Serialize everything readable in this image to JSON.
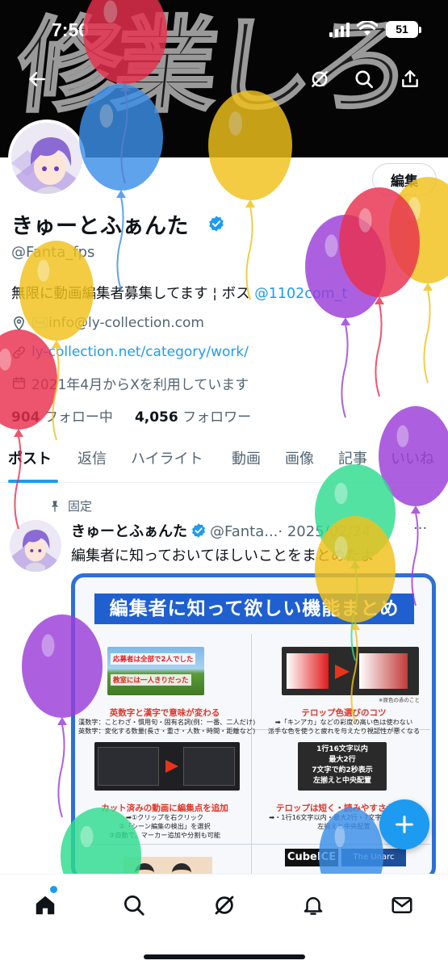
{
  "status_bar": {
    "time": "7:50",
    "battery": "51"
  },
  "banner": {
    "art_text": "修業しろ"
  },
  "header": {
    "back_icon": "arrow-left-icon",
    "grok_icon": "grok-icon",
    "search_icon": "search-icon",
    "share_icon": "share-icon"
  },
  "profile": {
    "edit_label": "編集",
    "display_name": "きゅーとふぁんた",
    "handle": "@Fanta_fps",
    "bio_text": "無限に動画編集者募集してます ¦ ボス ",
    "bio_link": "@1102com_t",
    "email": "✉️info@ly-collection.com",
    "website": "ly-collection.net/category/work/",
    "joined": "2021年4月からXを利用しています",
    "following_count": "904",
    "following_label": "フォロー中",
    "followers_count": "4,056",
    "followers_label": "フォロワー"
  },
  "tabs": [
    "ポスト",
    "返信",
    "ハイライト",
    "動画",
    "画像",
    "記事",
    "いいね"
  ],
  "post": {
    "pinned_label": "固定",
    "name": "きゅーとふぁんた",
    "handle": "@Fanta...",
    "date": "· 2025/02/24",
    "more": "···",
    "text": "編集者に知っておいてほしいことをまとめたよ",
    "image": {
      "title": "編集者に知って欲しい機能まとめ",
      "cells": [
        {
          "thumb_text_1": "応募者は全部で2人でした",
          "thumb_text_2": "教室には一人きりだった",
          "heading": "英数字と漢字で意味が変わる",
          "desc_1": "漢数字：ことわざ・慣用句・固有名詞(例：一番、二人だけ)",
          "desc_2": "英数字：変化する数量(長さ・重さ・人数・時間・距離など)"
        },
        {
          "note": "※原色の赤のこと",
          "heading": "テロップ色選びのコツ",
          "desc_1": "➡「キンアカ」などの彩度の高い色は使わない",
          "desc_2": "派手な色を使うと疲れを与えたり視認性が悪くなる"
        },
        {
          "heading": "カット済みの動画に編集点を追加",
          "desc_1": "➡①クリップを右クリック",
          "desc_2": "②「シーン編集の検出」を選択",
          "desc_3": "③自動で、マーカー追加や分割も可能"
        },
        {
          "thumb_lines": [
            "1行16文字以内",
            "最大2行",
            "7文字で約2秒表示",
            "左揃えと中央配置"
          ],
          "heading": "テロップは短く・読みやすさが基本",
          "desc_1": "➡・1行16文字以内・最大2行・7文字で約2秒表示",
          "desc_2": "左揃えと中央配置"
        },
        {
          "logo_text": "CubeICE",
          "logo_text_2": "The Unarc"
        }
      ]
    }
  },
  "nav": {
    "items": [
      "home-icon",
      "search-icon",
      "grok-icon",
      "bell-icon",
      "mail-icon"
    ]
  },
  "colors": {
    "accent": "#1d9bf0",
    "text": "#0f1419",
    "muted": "#536471",
    "card_border": "#2f6fd6",
    "card_title_bg": "#1f5fd0",
    "warning_red": "#e0362b"
  },
  "balloons": [
    {
      "color": "#e8304e"
    },
    {
      "color": "#3b8fe8"
    },
    {
      "color": "#f1c21b"
    },
    {
      "color": "#e8304e"
    },
    {
      "color": "#f1c21b"
    },
    {
      "color": "#9a3ed8"
    },
    {
      "color": "#f1c21b"
    },
    {
      "color": "#e8304e"
    },
    {
      "color": "#9a3ed8"
    },
    {
      "color": "#2fdc8f"
    },
    {
      "color": "#f1c21b"
    },
    {
      "color": "#9a3ed8"
    },
    {
      "color": "#2fdc8f"
    },
    {
      "color": "#3b8fe8"
    }
  ]
}
